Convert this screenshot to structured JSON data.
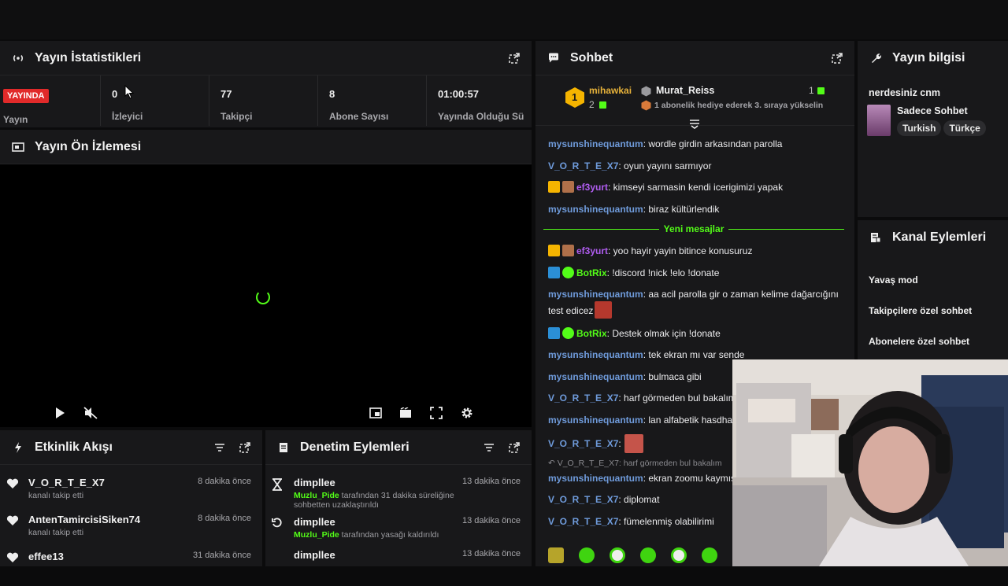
{
  "stats": {
    "title": "Yayın İstatistikleri",
    "live_badge": "YAYINDA",
    "cells": [
      {
        "value": "",
        "label": "Yayın"
      },
      {
        "value": "0",
        "label": "İzleyici"
      },
      {
        "value": "77",
        "label": "Takipçi"
      },
      {
        "value": "8",
        "label": "Abone Sayısı"
      },
      {
        "value": "01:00:57",
        "label": "Yayında Olduğu Sü"
      }
    ]
  },
  "preview": {
    "title": "Yayın Ön İzlemesi"
  },
  "activity": {
    "title": "Etkinlik Akışı",
    "items": [
      {
        "name": "V_O_R_T_E_X7",
        "sub": "kanalı takip etti",
        "time": "8 dakika önce"
      },
      {
        "name": "AntenTamircisiSiken74",
        "sub": "kanalı takip etti",
        "time": "8 dakika önce"
      },
      {
        "name": "effee13",
        "sub": "",
        "time": "31 dakika önce"
      }
    ]
  },
  "modlog": {
    "title": "Denetim Eylemleri",
    "items": [
      {
        "name": "dimpllee",
        "actor": "Muzlu_Pide",
        "sub": " tarafından 31 dakika süreliğine sohbetten uzaklaştırıldı",
        "time": "13 dakika önce"
      },
      {
        "name": "dimpllee",
        "actor": "Muzlu_Pide",
        "sub": " tarafından yasağı kaldırıldı",
        "time": "13 dakika önce"
      },
      {
        "name": "dimpllee",
        "actor": "",
        "sub": "",
        "time": "13 dakika önce"
      }
    ]
  },
  "chat": {
    "title": "Sohbet",
    "pinned": {
      "rank_num": "1",
      "gifter": "mihawkai",
      "gifter_count": "2",
      "name": "Murat_Reiss",
      "count": "1",
      "sub": "1 abonelik hediye ederek 3. sıraya yükselin"
    },
    "separator": "Yeni mesajlar",
    "messages": [
      {
        "user": "mysunshinequantum",
        "color": "blue",
        "text": ": wordle girdin arkasından parolla"
      },
      {
        "user": "V_O_R_T_E_X7",
        "color": "blue",
        "text": ": oyun yayını sarmıyor"
      },
      {
        "user": "ef3yurt",
        "color": "purple",
        "text": ": kimseyi sarmasin kendi icerigimizi yapak",
        "badges": true
      },
      {
        "user": "mysunshinequantum",
        "color": "blue",
        "text": ": biraz kültürlendik"
      },
      {
        "user": "ef3yurt",
        "color": "purple",
        "text": ": yoo hayir yayin bitince konusuruz",
        "badges": true
      },
      {
        "user": "BotRix",
        "color": "green",
        "text": ": !discord !nick !elo !donate",
        "bot": true
      },
      {
        "user": "mysunshinequantum",
        "color": "blue",
        "text": ": aa acil parolla gir o zaman kelime dağarcığını test edicez"
      },
      {
        "user": "BotRix",
        "color": "green",
        "text": ": Destek olmak için !donate",
        "bot": true
      },
      {
        "user": "mysunshinequantum",
        "color": "blue",
        "text": ": tek ekran mı var sende"
      },
      {
        "user": "mysunshinequantum",
        "color": "blue",
        "text": ": bulmaca gibi"
      },
      {
        "user": "V_O_R_T_E_X7",
        "color": "blue",
        "text": ": harf görmeden bul bakalım @mysunshinequantum"
      },
      {
        "user": "mysunshinequantum",
        "color": "blue",
        "text": ": lan alfabetik hasdha"
      },
      {
        "user": "V_O_R_T_E_X7",
        "color": "blue",
        "text": ":"
      },
      {
        "user": "",
        "color": "reply",
        "text": "V_O_R_T_E_X7: harf görmeden bul bakalım"
      },
      {
        "user": "mysunshinequantum",
        "color": "blue",
        "text": ": ekran zoomu kaymış"
      },
      {
        "user": "V_O_R_T_E_X7",
        "color": "blue",
        "text": ": diplomat"
      },
      {
        "user": "V_O_R_T_E_X7",
        "color": "blue",
        "text": ": fümelenmiş olabilirimi"
      }
    ]
  },
  "info": {
    "title": "Yayın bilgisi",
    "stream_title": "nerdesiniz cnm",
    "category": "Sadece Sohbet",
    "tags": [
      "Turkish",
      "Türkçe"
    ]
  },
  "actions": {
    "title": "Kanal Eylemleri",
    "items": [
      "Yavaş mod",
      "Takipçilere özel sohbet",
      "Abonelere özel sohbet"
    ]
  },
  "colors": {
    "accent": "#53fc18",
    "live": "#e12a2a",
    "panel": "#18181a"
  }
}
